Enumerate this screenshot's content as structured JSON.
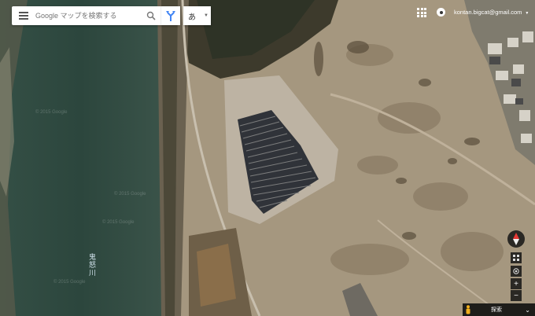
{
  "search": {
    "placeholder": "Google マップを検索する"
  },
  "ime": {
    "label": "あ"
  },
  "account": {
    "email": "kontan.bigcat@gmail.com"
  },
  "map": {
    "river_label": "鬼怒川",
    "watermark": "© 2015 Google",
    "layer": "satellite"
  },
  "controls": {
    "zoom_in": "+",
    "zoom_out": "−",
    "explore": "探索"
  },
  "colors": {
    "river": "#2f4a40",
    "bank": "#7a7a66",
    "ground": "#a89a86",
    "solar_panel": "#2b2f38"
  }
}
